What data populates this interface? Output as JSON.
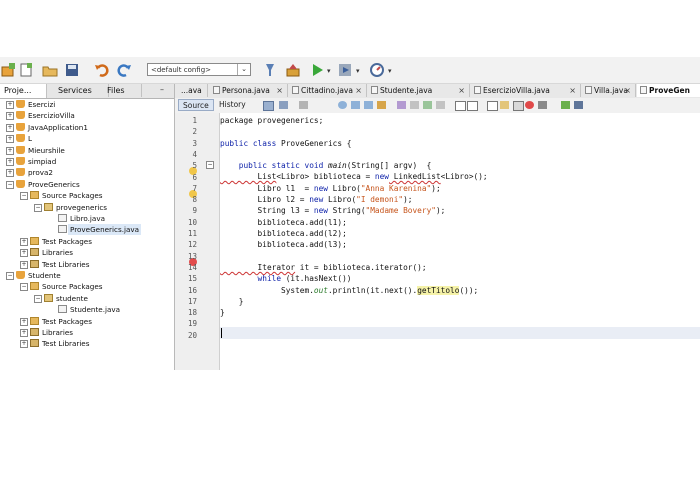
{
  "toolbar": {
    "config_value": "<default config>",
    "icons": [
      "new-project-icon",
      "new-file-icon",
      "open-project-icon",
      "save-all-icon",
      "undo-icon",
      "redo-icon",
      "clean-build-icon",
      "build-icon",
      "run-icon",
      "debug-icon",
      "profile-icon"
    ]
  },
  "left_panel": {
    "tabs": [
      "Proje...",
      "Services",
      "Files"
    ],
    "tree": [
      {
        "label": "Esercizi",
        "depth": 0,
        "icon": "project",
        "expanded": false
      },
      {
        "label": "EsercizioVilla",
        "depth": 0,
        "icon": "project",
        "expanded": false
      },
      {
        "label": "JavaApplication1",
        "depth": 0,
        "icon": "project",
        "expanded": false
      },
      {
        "label": "L",
        "depth": 0,
        "icon": "project",
        "expanded": false
      },
      {
        "label": "Mieurshile",
        "depth": 0,
        "icon": "project",
        "expanded": false
      },
      {
        "label": "simpiad",
        "depth": 0,
        "icon": "project",
        "expanded": false
      },
      {
        "label": "prova2",
        "depth": 0,
        "icon": "project",
        "expanded": false
      },
      {
        "label": "ProveGenerics",
        "depth": 0,
        "icon": "project",
        "expanded": true
      },
      {
        "label": "Source Packages",
        "depth": 1,
        "icon": "folder",
        "expanded": true
      },
      {
        "label": "provegenerics",
        "depth": 2,
        "icon": "package",
        "expanded": true
      },
      {
        "label": "Libro.java",
        "depth": 3,
        "icon": "file"
      },
      {
        "label": "ProveGenerics.java",
        "depth": 3,
        "icon": "file",
        "selected": true
      },
      {
        "label": "Test Packages",
        "depth": 1,
        "icon": "folder",
        "expanded": false
      },
      {
        "label": "Libraries",
        "depth": 1,
        "icon": "library",
        "expanded": false
      },
      {
        "label": "Test Libraries",
        "depth": 1,
        "icon": "library",
        "expanded": false
      },
      {
        "label": "Studente",
        "depth": 0,
        "icon": "project",
        "expanded": true
      },
      {
        "label": "Source Packages",
        "depth": 1,
        "icon": "folder",
        "expanded": true
      },
      {
        "label": "studente",
        "depth": 2,
        "icon": "package",
        "expanded": true
      },
      {
        "label": "Studente.java",
        "depth": 3,
        "icon": "file"
      },
      {
        "label": "Test Packages",
        "depth": 1,
        "icon": "folder",
        "expanded": false
      },
      {
        "label": "Libraries",
        "depth": 1,
        "icon": "library",
        "expanded": false
      },
      {
        "label": "Test Libraries",
        "depth": 1,
        "icon": "library",
        "expanded": false
      }
    ]
  },
  "editor": {
    "tabs": [
      {
        "label": "...ava",
        "closable": false
      },
      {
        "label": "Persona.java",
        "closable": true
      },
      {
        "label": "Cittadino.java",
        "closable": true
      },
      {
        "label": "Studente.java",
        "closable": true
      },
      {
        "label": "EsercizioVilla.java",
        "closable": true
      },
      {
        "label": "Villa.java",
        "closable": true
      },
      {
        "label": "ProveGen",
        "closable": false,
        "active": true
      }
    ],
    "source_label": "Source",
    "history_label": "History",
    "line_numbers": [
      "1",
      "2",
      "3",
      "4",
      "5",
      "6",
      "7",
      "8",
      "9",
      "10",
      "11",
      "12",
      "13",
      "14",
      "15",
      "16",
      "17",
      "18",
      "19",
      "20"
    ],
    "code": {
      "l1": "package provegenerics;",
      "l3a": "public class",
      "l3b": " ProveGenerics {",
      "l5a": "    public static void",
      "l5b": " main",
      "l5c": "(String[] argv)  {",
      "l6a": "        List",
      "l6b": "<Libro> biblioteca = ",
      "l6c": "new",
      "l6d": " LinkedList",
      "l6e": "<Libro>();",
      "l7a": "        Libro l1  = ",
      "l7b": "new",
      "l7c": " Libro(",
      "l7d": "\"Anna Karenina\"",
      "l7e": ");",
      "l8a": "        Libro l2 = ",
      "l8b": "new",
      "l8c": " Libro(",
      "l8d": "\"I demoni\"",
      "l8e": ");",
      "l9a": "        String l3 = ",
      "l9b": "new",
      "l9c": " String(",
      "l9d": "\"Madame Bovery\"",
      "l9e": ");",
      "l10a": "        biblioteca.",
      "l10b": "add",
      "l10c": "(l1);",
      "l11a": "        biblioteca.",
      "l11b": "add",
      "l11c": "(l2);",
      "l12a": "        biblioteca.",
      "l12b": "add",
      "l12c": "(l3);",
      "l14a": "        Iterator",
      "l14b": " it = biblioteca.",
      "l14c": "iterator",
      "l14d": "();",
      "l15a": "        while",
      "l15b": " (it.",
      "l15c": "hasNext",
      "l15d": "())",
      "l16a": "             System.",
      "l16b": "out",
      "l16c": ".println(it.",
      "l16d": "next",
      "l16e": "().",
      "l16f": "getTitolo",
      "l16g": "());",
      "l17": "    }",
      "l18": "}"
    }
  },
  "colors": {
    "keyword": "#0b1fa8",
    "string": "#c6541b",
    "selection": "#dbe8f7"
  }
}
